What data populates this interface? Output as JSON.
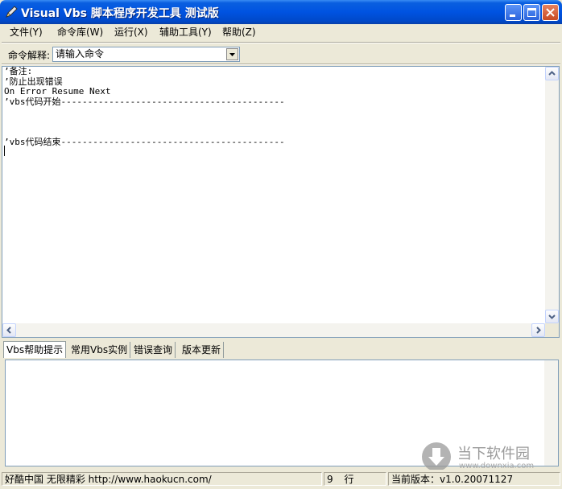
{
  "window": {
    "title": "Visual Vbs 脚本程序开发工具 测试版"
  },
  "menu": [
    {
      "label": "文件(Y)"
    },
    {
      "label": "命令库(W)"
    },
    {
      "label": "运行(X)"
    },
    {
      "label": "辅助工具(Y)"
    },
    {
      "label": "帮助(Z)"
    }
  ],
  "command": {
    "label": "命令解释:",
    "selected": "请输入命令"
  },
  "editor": {
    "lines": [
      "’备注:",
      "’防止出现错误",
      "On Error Resume Next",
      "’vbs代码开始------------------------------------------",
      "",
      "",
      "",
      "’vbs代码结束------------------------------------------"
    ]
  },
  "tabs": [
    {
      "label": "Vbs帮助提示"
    },
    {
      "label": "常用Vbs实例"
    },
    {
      "label": "错误查询"
    },
    {
      "label": "版本更新"
    }
  ],
  "watermark": {
    "name": "当下软件园",
    "url": "www.downxia.com"
  },
  "status": {
    "site": "好酷中国 无限精彩 http://www.haokucn.com/",
    "line_number": "9",
    "line_label": "行",
    "version": "当前版本：v1.0.20071127"
  }
}
